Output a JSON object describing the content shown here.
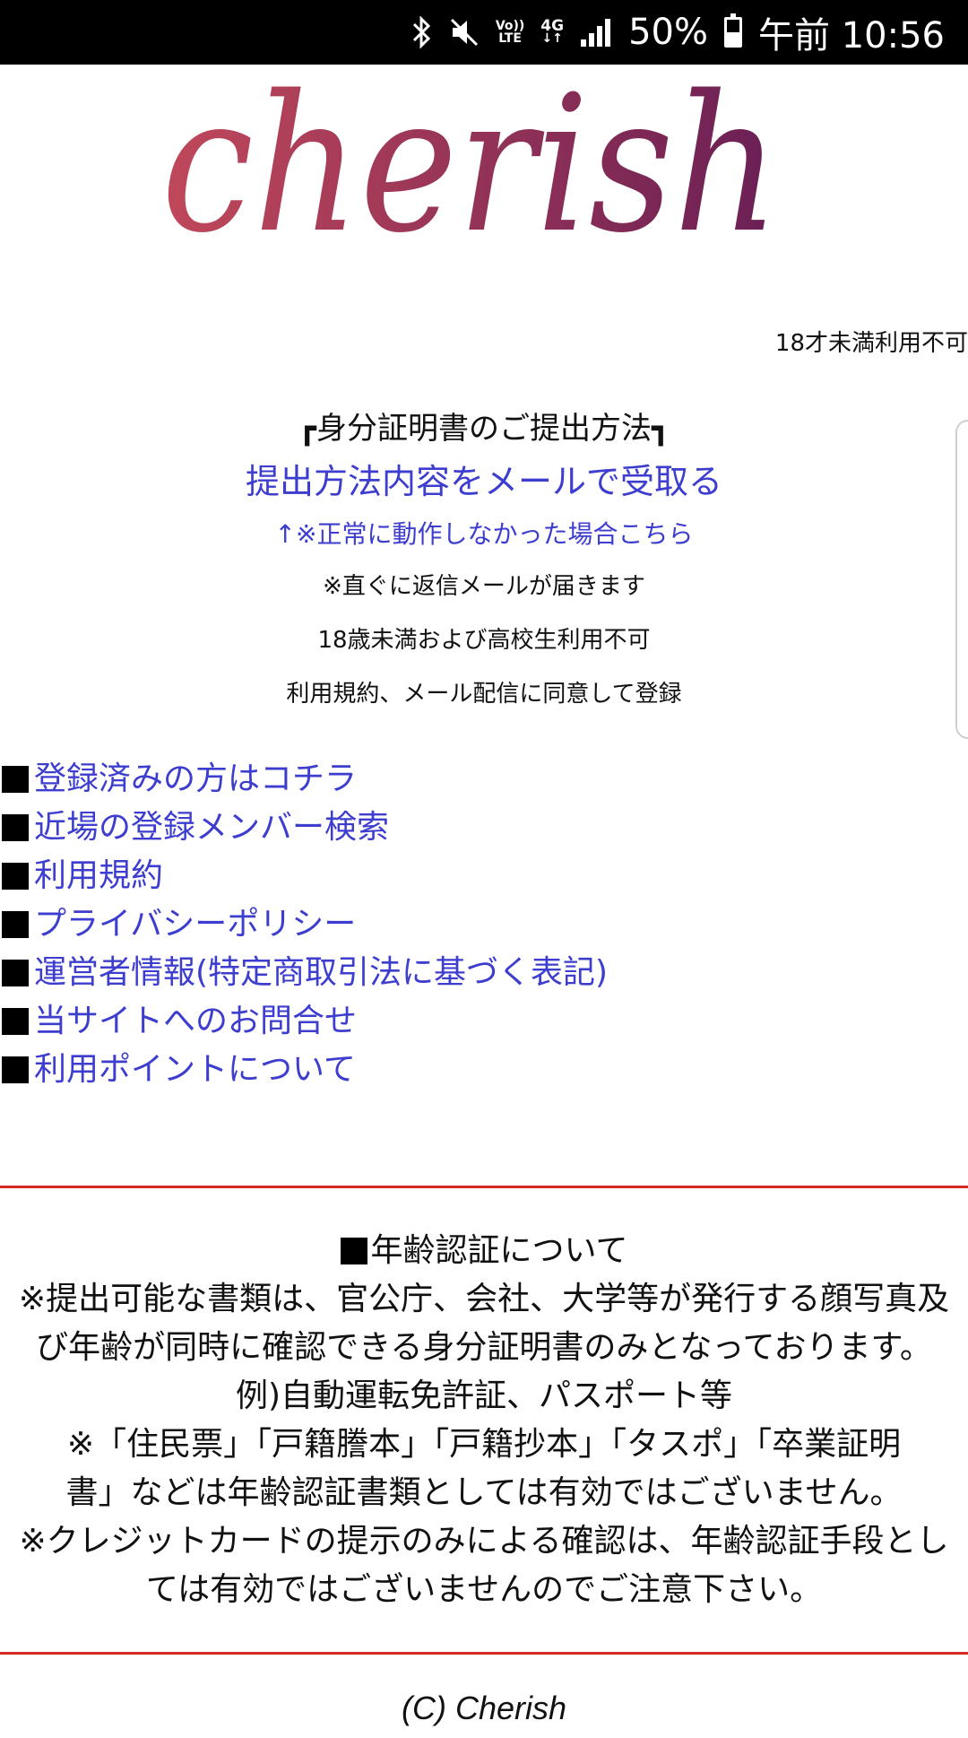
{
  "status_bar": {
    "icons": [
      "bluetooth-icon",
      "mute-icon",
      "volte-icon",
      "network-4g-icon",
      "signal-icon"
    ],
    "volte_top": "Vo))",
    "volte_bottom": "LTE",
    "net_top": "4G",
    "net_bottom": "↓↑",
    "battery_percent": "50%",
    "battery_level": 0.5,
    "time": "午前 10:56"
  },
  "logo": {
    "text": "cherish",
    "colors": [
      "#c0485a",
      "#6a1f55"
    ]
  },
  "age_note": "18才未満利用不可",
  "submission": {
    "title": "┏身分証明書のご提出方法┓",
    "email_link": "提出方法内容をメールで受取る",
    "fallback_link": "↑※正常に動作しなかった場合こちら",
    "reply_note": "※直ぐに返信メールが届きます",
    "restriction": "18歳未満および高校生利用不可",
    "agreement": "利用規約、メール配信に同意して登録"
  },
  "menu": {
    "items": [
      {
        "label": "登録済みの方はコチラ"
      },
      {
        "label": "近場の登録メンバー検索"
      },
      {
        "label": "利用規約"
      },
      {
        "label": "プライバシーポリシー"
      },
      {
        "label": "運営者情報(特定商取引法に基づく表記)"
      },
      {
        "label": "当サイトへのお問合せ"
      },
      {
        "label": "利用ポイントについて"
      }
    ]
  },
  "age_verification": {
    "heading": "年齢認証について",
    "line1": "※提出可能な書類は、官公庁、会社、大学等が発行する顔写真及",
    "line2": "び年齢が同時に確認できる身分証明書のみとなっております。",
    "line3": "例)自動運転免許証、パスポート等",
    "line4": "※「住民票」「戸籍謄本」「戸籍抄本」「タスポ」「卒業証明",
    "line5": "書」などは年齢認証書類としては有効ではございません。",
    "line6": "※クレジットカードの提示のみによる確認は、年齢認証手段とし",
    "line7": "ては有効ではございませんのでご注意下さい。"
  },
  "colors": {
    "link": "#3d3dcf",
    "divider": "#d62828",
    "status_bar_bg": "#000000"
  },
  "footer": "(C)  Cherish"
}
